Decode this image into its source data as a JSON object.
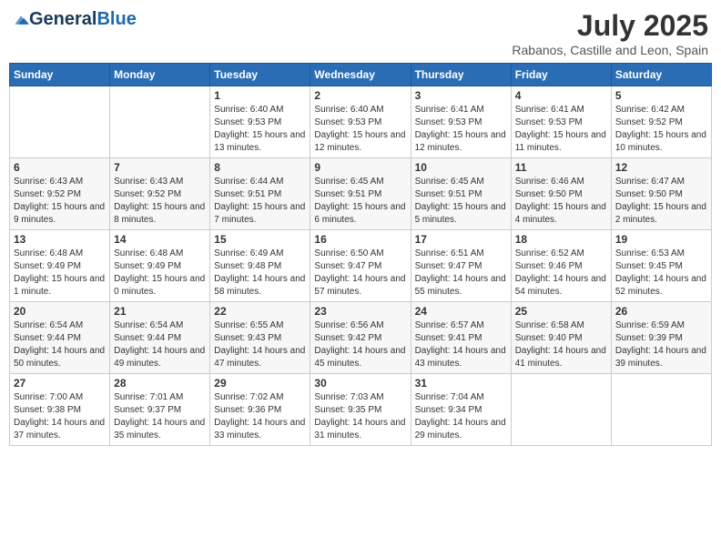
{
  "header": {
    "logo_general": "General",
    "logo_blue": "Blue",
    "month_year": "July 2025",
    "location": "Rabanos, Castille and Leon, Spain"
  },
  "weekdays": [
    "Sunday",
    "Monday",
    "Tuesday",
    "Wednesday",
    "Thursday",
    "Friday",
    "Saturday"
  ],
  "weeks": [
    [
      {
        "day": "",
        "sunrise": "",
        "sunset": "",
        "daylight": ""
      },
      {
        "day": "",
        "sunrise": "",
        "sunset": "",
        "daylight": ""
      },
      {
        "day": "1",
        "sunrise": "Sunrise: 6:40 AM",
        "sunset": "Sunset: 9:53 PM",
        "daylight": "Daylight: 15 hours and 13 minutes."
      },
      {
        "day": "2",
        "sunrise": "Sunrise: 6:40 AM",
        "sunset": "Sunset: 9:53 PM",
        "daylight": "Daylight: 15 hours and 12 minutes."
      },
      {
        "day": "3",
        "sunrise": "Sunrise: 6:41 AM",
        "sunset": "Sunset: 9:53 PM",
        "daylight": "Daylight: 15 hours and 12 minutes."
      },
      {
        "day": "4",
        "sunrise": "Sunrise: 6:41 AM",
        "sunset": "Sunset: 9:53 PM",
        "daylight": "Daylight: 15 hours and 11 minutes."
      },
      {
        "day": "5",
        "sunrise": "Sunrise: 6:42 AM",
        "sunset": "Sunset: 9:52 PM",
        "daylight": "Daylight: 15 hours and 10 minutes."
      }
    ],
    [
      {
        "day": "6",
        "sunrise": "Sunrise: 6:43 AM",
        "sunset": "Sunset: 9:52 PM",
        "daylight": "Daylight: 15 hours and 9 minutes."
      },
      {
        "day": "7",
        "sunrise": "Sunrise: 6:43 AM",
        "sunset": "Sunset: 9:52 PM",
        "daylight": "Daylight: 15 hours and 8 minutes."
      },
      {
        "day": "8",
        "sunrise": "Sunrise: 6:44 AM",
        "sunset": "Sunset: 9:51 PM",
        "daylight": "Daylight: 15 hours and 7 minutes."
      },
      {
        "day": "9",
        "sunrise": "Sunrise: 6:45 AM",
        "sunset": "Sunset: 9:51 PM",
        "daylight": "Daylight: 15 hours and 6 minutes."
      },
      {
        "day": "10",
        "sunrise": "Sunrise: 6:45 AM",
        "sunset": "Sunset: 9:51 PM",
        "daylight": "Daylight: 15 hours and 5 minutes."
      },
      {
        "day": "11",
        "sunrise": "Sunrise: 6:46 AM",
        "sunset": "Sunset: 9:50 PM",
        "daylight": "Daylight: 15 hours and 4 minutes."
      },
      {
        "day": "12",
        "sunrise": "Sunrise: 6:47 AM",
        "sunset": "Sunset: 9:50 PM",
        "daylight": "Daylight: 15 hours and 2 minutes."
      }
    ],
    [
      {
        "day": "13",
        "sunrise": "Sunrise: 6:48 AM",
        "sunset": "Sunset: 9:49 PM",
        "daylight": "Daylight: 15 hours and 1 minute."
      },
      {
        "day": "14",
        "sunrise": "Sunrise: 6:48 AM",
        "sunset": "Sunset: 9:49 PM",
        "daylight": "Daylight: 15 hours and 0 minutes."
      },
      {
        "day": "15",
        "sunrise": "Sunrise: 6:49 AM",
        "sunset": "Sunset: 9:48 PM",
        "daylight": "Daylight: 14 hours and 58 minutes."
      },
      {
        "day": "16",
        "sunrise": "Sunrise: 6:50 AM",
        "sunset": "Sunset: 9:47 PM",
        "daylight": "Daylight: 14 hours and 57 minutes."
      },
      {
        "day": "17",
        "sunrise": "Sunrise: 6:51 AM",
        "sunset": "Sunset: 9:47 PM",
        "daylight": "Daylight: 14 hours and 55 minutes."
      },
      {
        "day": "18",
        "sunrise": "Sunrise: 6:52 AM",
        "sunset": "Sunset: 9:46 PM",
        "daylight": "Daylight: 14 hours and 54 minutes."
      },
      {
        "day": "19",
        "sunrise": "Sunrise: 6:53 AM",
        "sunset": "Sunset: 9:45 PM",
        "daylight": "Daylight: 14 hours and 52 minutes."
      }
    ],
    [
      {
        "day": "20",
        "sunrise": "Sunrise: 6:54 AM",
        "sunset": "Sunset: 9:44 PM",
        "daylight": "Daylight: 14 hours and 50 minutes."
      },
      {
        "day": "21",
        "sunrise": "Sunrise: 6:54 AM",
        "sunset": "Sunset: 9:44 PM",
        "daylight": "Daylight: 14 hours and 49 minutes."
      },
      {
        "day": "22",
        "sunrise": "Sunrise: 6:55 AM",
        "sunset": "Sunset: 9:43 PM",
        "daylight": "Daylight: 14 hours and 47 minutes."
      },
      {
        "day": "23",
        "sunrise": "Sunrise: 6:56 AM",
        "sunset": "Sunset: 9:42 PM",
        "daylight": "Daylight: 14 hours and 45 minutes."
      },
      {
        "day": "24",
        "sunrise": "Sunrise: 6:57 AM",
        "sunset": "Sunset: 9:41 PM",
        "daylight": "Daylight: 14 hours and 43 minutes."
      },
      {
        "day": "25",
        "sunrise": "Sunrise: 6:58 AM",
        "sunset": "Sunset: 9:40 PM",
        "daylight": "Daylight: 14 hours and 41 minutes."
      },
      {
        "day": "26",
        "sunrise": "Sunrise: 6:59 AM",
        "sunset": "Sunset: 9:39 PM",
        "daylight": "Daylight: 14 hours and 39 minutes."
      }
    ],
    [
      {
        "day": "27",
        "sunrise": "Sunrise: 7:00 AM",
        "sunset": "Sunset: 9:38 PM",
        "daylight": "Daylight: 14 hours and 37 minutes."
      },
      {
        "day": "28",
        "sunrise": "Sunrise: 7:01 AM",
        "sunset": "Sunset: 9:37 PM",
        "daylight": "Daylight: 14 hours and 35 minutes."
      },
      {
        "day": "29",
        "sunrise": "Sunrise: 7:02 AM",
        "sunset": "Sunset: 9:36 PM",
        "daylight": "Daylight: 14 hours and 33 minutes."
      },
      {
        "day": "30",
        "sunrise": "Sunrise: 7:03 AM",
        "sunset": "Sunset: 9:35 PM",
        "daylight": "Daylight: 14 hours and 31 minutes."
      },
      {
        "day": "31",
        "sunrise": "Sunrise: 7:04 AM",
        "sunset": "Sunset: 9:34 PM",
        "daylight": "Daylight: 14 hours and 29 minutes."
      },
      {
        "day": "",
        "sunrise": "",
        "sunset": "",
        "daylight": ""
      },
      {
        "day": "",
        "sunrise": "",
        "sunset": "",
        "daylight": ""
      }
    ]
  ]
}
